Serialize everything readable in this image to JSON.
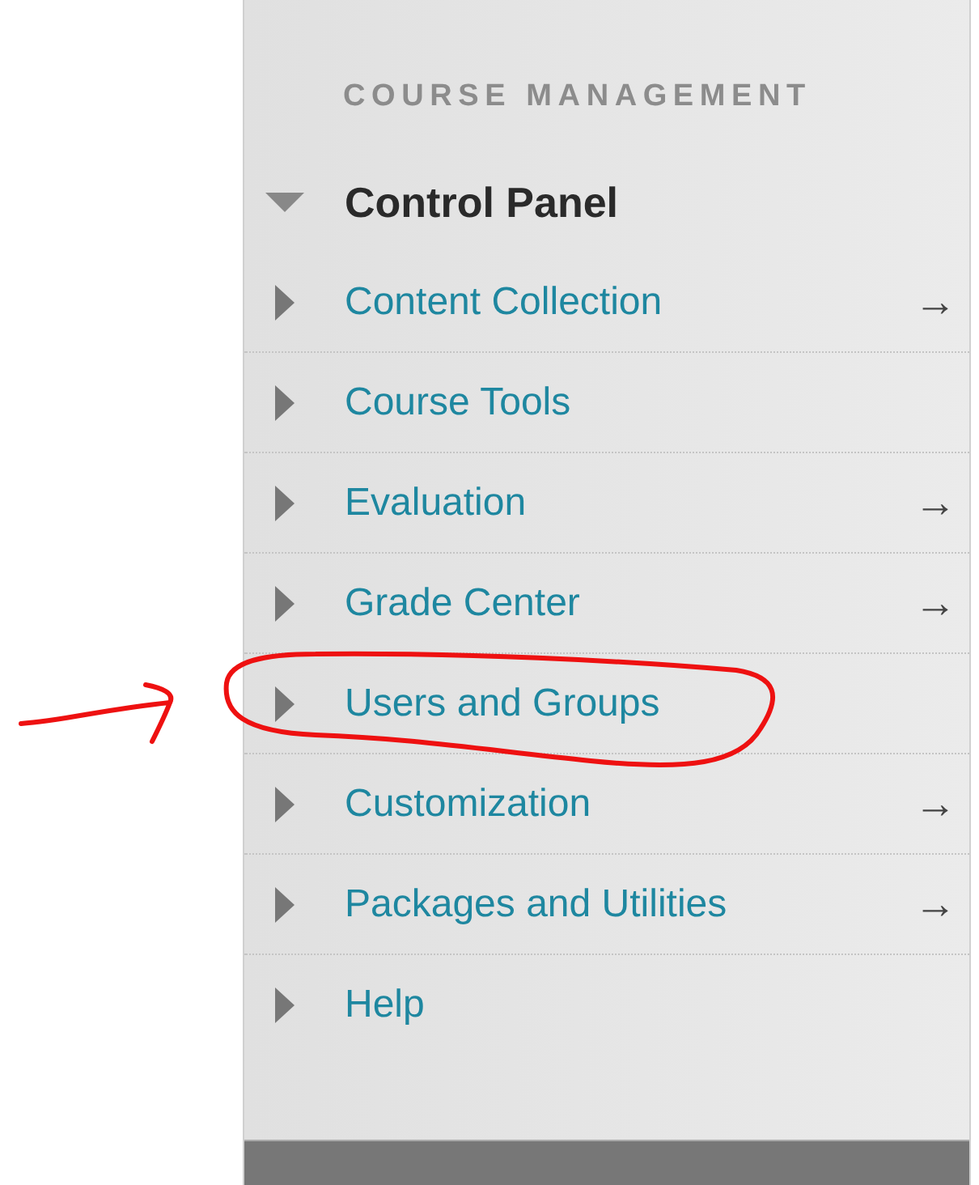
{
  "panel": {
    "section_title": "COURSE MANAGEMENT",
    "control_panel": {
      "label": "Control Panel",
      "expanded": true
    },
    "items": [
      {
        "label": "Content Collection",
        "expanded": false,
        "link_icon": "→"
      },
      {
        "label": "Course Tools",
        "expanded": false
      },
      {
        "label": "Evaluation",
        "expanded": false,
        "link_icon": "→"
      },
      {
        "label": "Grade Center",
        "expanded": false,
        "link_icon": "→"
      },
      {
        "label": "Users and Groups",
        "expanded": false
      },
      {
        "label": "Customization",
        "expanded": false,
        "link_icon": "→"
      },
      {
        "label": "Packages and Utilities",
        "expanded": false,
        "link_icon": "→"
      },
      {
        "label": "Help",
        "expanded": false
      }
    ]
  }
}
